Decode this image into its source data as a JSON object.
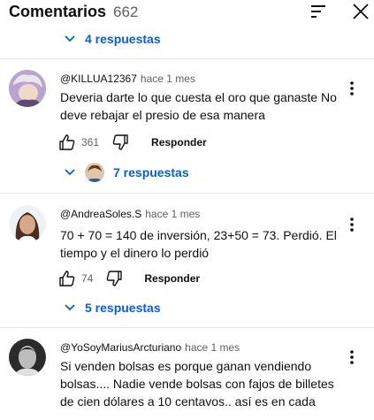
{
  "header": {
    "title": "Comentarios",
    "count": "662"
  },
  "thread0": {
    "replies_label": "4 respuestas"
  },
  "comments": [
    {
      "author": "@KILLUA12367",
      "time": "hace 1 mes",
      "text": "Deveria darte lo que cuesta el oro que ganaste No deve rebajar el presio de esa manera",
      "likes": "361",
      "reply_label": "Responder",
      "replies_label": "7 respuestas"
    },
    {
      "author": "@AndreaSoles.S",
      "time": "hace 1 mes",
      "text": "70 + 70 = 140 de inversión, 23+50 = 73. Perdió. El tiempo y el dinero lo perdió",
      "likes": "74",
      "reply_label": "Responder",
      "replies_label": "5 respuestas"
    },
    {
      "author": "@YoSoyMariusArcturiano",
      "time": "hace 1 mes",
      "text": "Si venden bolsas es porque ganan vendiendo bolsas.... Nadie vende bolsas con fajos de billetes de cien dólares a 10 centavos.. así es en cada"
    }
  ],
  "colors": {
    "link": "#065fd4",
    "secondary": "#606060",
    "divider": "#e5e5e5"
  }
}
